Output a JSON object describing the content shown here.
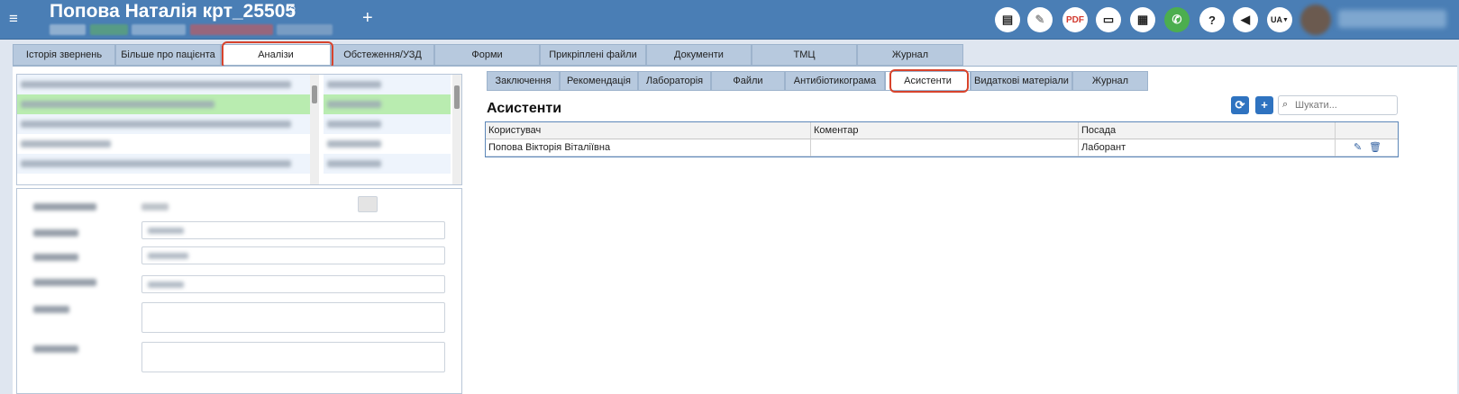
{
  "header": {
    "menu_icon": "menu-icon",
    "patient_name": "Попова Наталія крт_25505",
    "gender_symbol": "♀",
    "add_symbol": "+",
    "language": "UA",
    "icons": [
      "chat-icon",
      "sign-icon",
      "pdf-icon",
      "card-icon",
      "calculator-icon",
      "phone-icon",
      "help-icon",
      "megaphone-icon"
    ],
    "pdf_label": "PDF",
    "help_label": "?"
  },
  "top_tabs": [
    {
      "label": "Історія звернень"
    },
    {
      "label": "Більше про пацієнта"
    },
    {
      "label": "Аналізи"
    },
    {
      "label": "Обстеження/УЗД"
    },
    {
      "label": "Форми"
    },
    {
      "label": "Прикріплені файли"
    },
    {
      "label": "Документи"
    },
    {
      "label": "ТМЦ"
    },
    {
      "label": "Журнал"
    }
  ],
  "sub_tabs": [
    {
      "label": "Заключення"
    },
    {
      "label": "Рекомендація"
    },
    {
      "label": "Лабораторія"
    },
    {
      "label": "Файли"
    },
    {
      "label": "Антибіотикограма"
    },
    {
      "label": "Асистенти"
    },
    {
      "label": "Видаткові матеріали"
    },
    {
      "label": "Журнал"
    }
  ],
  "section": {
    "title": "Асистенти",
    "refresh_icon": "⟳",
    "add_icon": "+",
    "search_placeholder": "Шукати..."
  },
  "table": {
    "columns": [
      "Користувач",
      "Коментар",
      "Посада"
    ],
    "rows": [
      {
        "user": "Попова Вікторія Віталіївна",
        "comment": "",
        "position": "Лаборант"
      }
    ]
  },
  "colors": {
    "header_bg": "#4a7eb5",
    "tab_bg": "#b7c9de",
    "highlight": "#d7432c",
    "list_highlight": "#b9ecb0"
  }
}
